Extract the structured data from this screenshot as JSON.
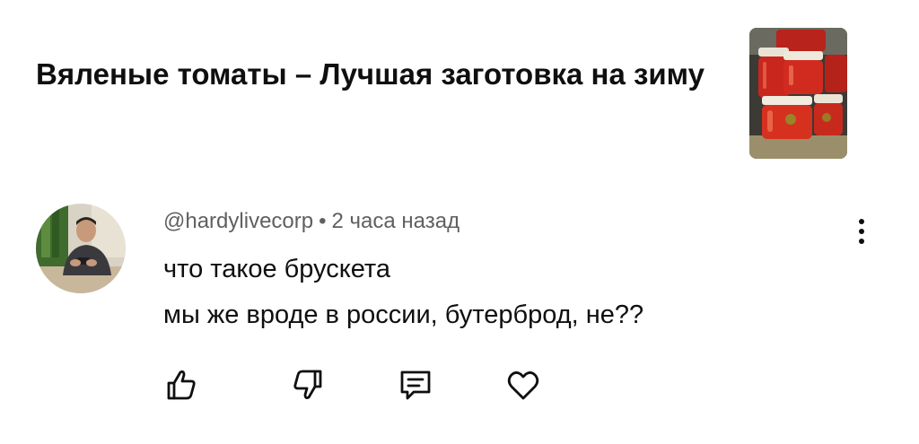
{
  "video": {
    "title": "Вяленые томаты – Лучшая заготовка на зиму",
    "thumbnail_icon": "tomato-jars-thumbnail"
  },
  "comment": {
    "author": "@hardylivecorp",
    "separator": "•",
    "time": "2 часа назад",
    "lines": [
      "что такое брускета",
      "мы же вроде в россии, бутерброд, не??"
    ],
    "avatar_icon": "user-avatar"
  },
  "actions": {
    "like_icon": "thumbs-up-icon",
    "dislike_icon": "thumbs-down-icon",
    "reply_icon": "comment-icon",
    "heart_icon": "heart-icon",
    "menu_icon": "more-vertical-icon"
  },
  "colors": {
    "text": "#0f0f0f",
    "meta": "#606060",
    "background": "#ffffff"
  }
}
